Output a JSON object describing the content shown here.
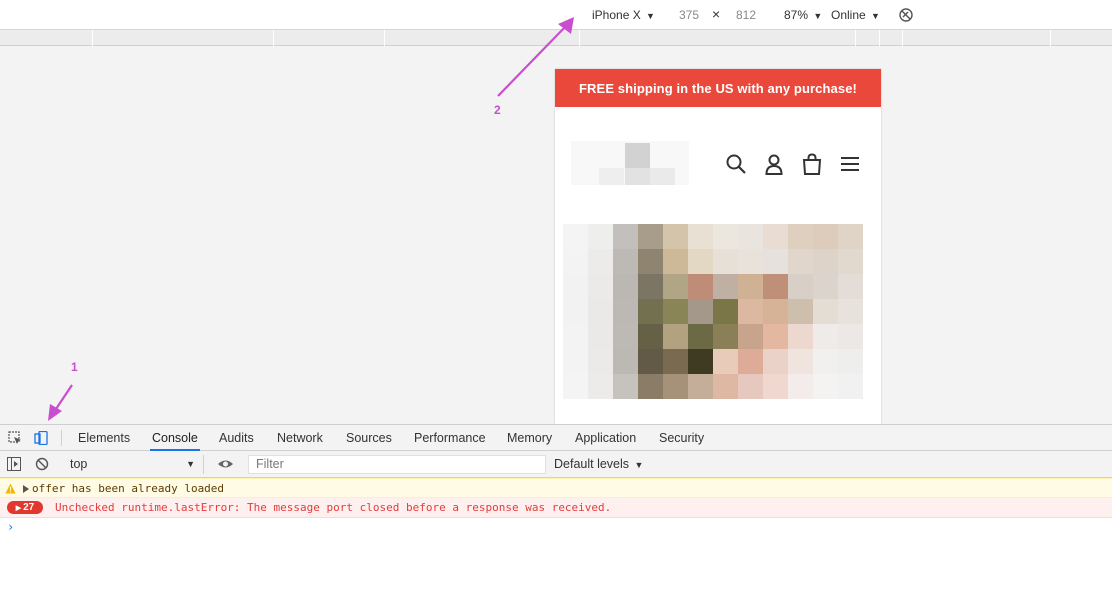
{
  "device_toolbar": {
    "device": "iPhone X",
    "width": "375",
    "times": "×",
    "height": "812",
    "zoom": "87%",
    "throttling": "Online",
    "dropdown_caret": "▼"
  },
  "page": {
    "promo_text": "FREE shipping in the US with any purchase!",
    "promo_color": "#e9483a",
    "header_icons": [
      "search-icon",
      "account-icon",
      "bag-icon",
      "menu-icon"
    ]
  },
  "annotations": {
    "one": "1",
    "two": "2",
    "color": "#c94ecf"
  },
  "devtools": {
    "tabs": [
      "Elements",
      "Console",
      "Audits",
      "Network",
      "Sources",
      "Performance",
      "Memory",
      "Application",
      "Security"
    ],
    "active_tab": "Console"
  },
  "console_toolbar": {
    "context": "top",
    "filter_placeholder": "Filter",
    "levels": "Default levels"
  },
  "console": {
    "warning_text": "offer has been already loaded",
    "error_count": "27",
    "error_text": "Unchecked runtime.lastError: The message port closed before a response was received.",
    "prompt_symbol": "›"
  }
}
